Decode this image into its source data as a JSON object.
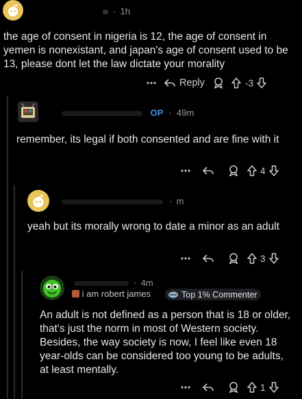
{
  "comments": [
    {
      "time": "1h",
      "text": "the age of consent in nigeria is 12, the age of consent in yemen is nonexistant, and japan's age of consent used to be 13, please dont let the law dictate your morality",
      "reply_label": "Reply",
      "score": "-3"
    },
    {
      "op_tag": "OP",
      "time": "49m",
      "text": "remember, its legal if both consented and are fine with it",
      "score": "4"
    },
    {
      "time": "m",
      "text": "yeah but its morally wrong to date a minor as an adult",
      "score": "3"
    },
    {
      "time": "4m",
      "flair": "i am robert james",
      "badge": "Top 1% Commenter",
      "text": "An adult is not defined as a person that is 18 or older, that's just the norm in most of Western society. Besides, the way society is now, I feel like even 18 year-olds can be considered too young to be adults, at least mentally.",
      "score": "1"
    }
  ],
  "icons": {
    "more": "more-options-icon",
    "reply": "reply-arrow-icon",
    "award": "award-icon",
    "upvote": "upvote-icon",
    "downvote": "downvote-icon"
  },
  "colors": {
    "background": "#000000",
    "text": "#e8e8e8",
    "meta": "#9a9a9a",
    "thread_line": "#2a2a2a",
    "avatar_yellow": "#e9c65b",
    "avatar_green": "#3fbf2a"
  }
}
